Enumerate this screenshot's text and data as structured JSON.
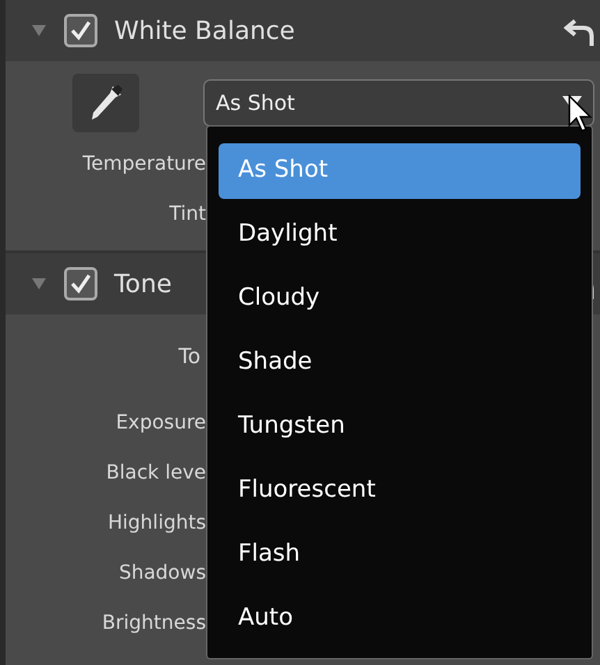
{
  "white_balance": {
    "title": "White Balance",
    "expanded": true,
    "checked": true,
    "preset": {
      "value": "As Shot"
    },
    "rows": [
      {
        "label": "Temperature"
      },
      {
        "label": "Tint"
      }
    ]
  },
  "tone": {
    "title": "Tone",
    "expanded": true,
    "checked": true,
    "tone_label": "To",
    "rows": [
      {
        "label": "Exposure"
      },
      {
        "label": "Black leve"
      },
      {
        "label": "Highlights"
      },
      {
        "label": "Shadows"
      },
      {
        "label": "Brightness"
      }
    ]
  },
  "dropdown": {
    "items": [
      {
        "label": "As Shot",
        "selected": true
      },
      {
        "label": "Daylight",
        "selected": false
      },
      {
        "label": "Cloudy",
        "selected": false
      },
      {
        "label": "Shade",
        "selected": false
      },
      {
        "label": "Tungsten",
        "selected": false
      },
      {
        "label": "Fluorescent",
        "selected": false
      },
      {
        "label": "Flash",
        "selected": false
      },
      {
        "label": "Auto",
        "selected": false
      }
    ]
  }
}
